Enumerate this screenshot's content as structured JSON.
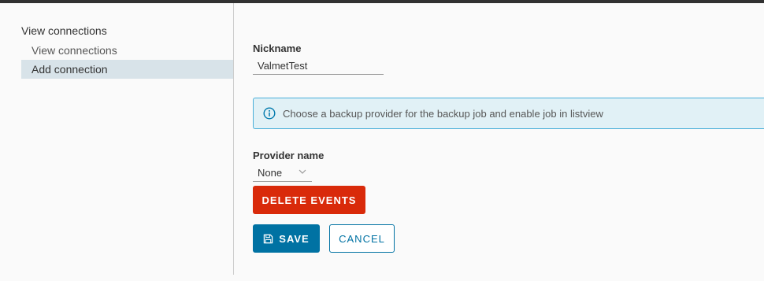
{
  "sidebar": {
    "title": "View connections",
    "items": [
      {
        "label": "View connections",
        "active": false
      },
      {
        "label": "Add connection",
        "active": true
      }
    ]
  },
  "form": {
    "nickname_label": "Nickname",
    "nickname_value": "ValmetTest",
    "alert_text": "Choose a backup provider for the backup job and enable job in listview",
    "provider_label": "Provider name",
    "provider_value": "None",
    "delete_events_label": "DELETE EVENTS",
    "save_label": "SAVE",
    "cancel_label": "CANCEL"
  },
  "colors": {
    "accent": "#0072a3",
    "danger": "#d92a0a",
    "info_bg": "#e1f1f6",
    "info_border": "#49afd9",
    "sidebar_active": "#d8e3e9"
  },
  "icons": {
    "alert": "info-circle-icon",
    "select": "chevron-down-icon",
    "save": "floppy-disk-icon"
  }
}
